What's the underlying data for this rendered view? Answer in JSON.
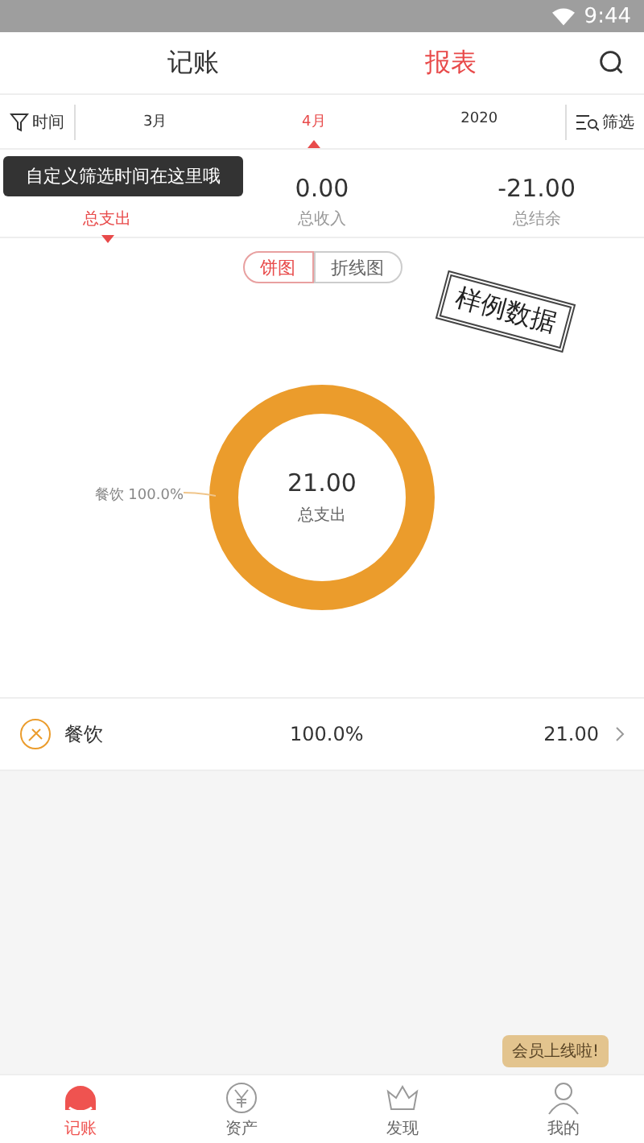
{
  "status_bar": {
    "time": "9:44"
  },
  "header": {
    "tabs": [
      {
        "label": "记账",
        "selected": false
      },
      {
        "label": "报表",
        "selected": true
      }
    ]
  },
  "filter_bar": {
    "time_button": "时间",
    "periods": [
      {
        "label": "3月",
        "selected": false
      },
      {
        "label": "4月",
        "selected": true
      },
      {
        "label": "2020",
        "selected": false
      }
    ],
    "filter_button": "筛选"
  },
  "tooltip": "自定义筛选时间在这里哦",
  "summary": [
    {
      "label": "总支出",
      "selected": true
    },
    {
      "value": "0.00",
      "label": "总收入",
      "selected": false
    },
    {
      "value": "-21.00",
      "label": "总结余",
      "selected": false
    }
  ],
  "chart_switch": [
    {
      "label": "饼图",
      "selected": true
    },
    {
      "label": "折线图",
      "selected": false
    }
  ],
  "stamp": "样例数据",
  "chart": {
    "center_value": "21.00",
    "center_label": "总支出",
    "slice_label": "餐饮 100.0%"
  },
  "categories": [
    {
      "name": "餐饮",
      "percent": "100.0%",
      "amount": "21.00"
    }
  ],
  "member_badge": "会员上线啦!",
  "bottom_nav": [
    {
      "label": "记账",
      "selected": true,
      "kind": "book"
    },
    {
      "label": "资产",
      "selected": false,
      "kind": "yen"
    },
    {
      "label": "发现",
      "selected": false,
      "kind": "crown"
    },
    {
      "label": "我的",
      "selected": false,
      "kind": "person"
    }
  ]
}
